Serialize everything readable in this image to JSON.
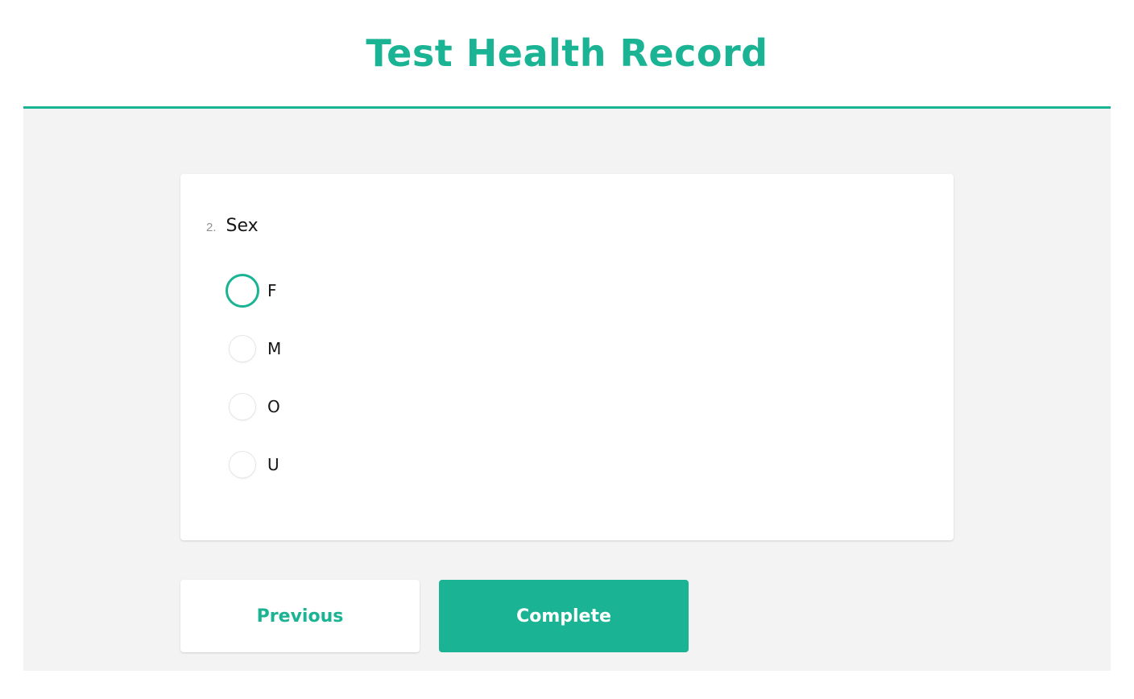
{
  "header": {
    "title": "Test Health Record"
  },
  "question": {
    "number": "2.",
    "text": "Sex",
    "options": [
      {
        "label": "F",
        "focused": true,
        "selected": false
      },
      {
        "label": "M",
        "focused": false,
        "selected": false
      },
      {
        "label": "O",
        "focused": false,
        "selected": false
      },
      {
        "label": "U",
        "focused": false,
        "selected": false
      }
    ]
  },
  "navigation": {
    "previous_label": "Previous",
    "complete_label": "Complete"
  },
  "colors": {
    "accent": "#1ab394",
    "background": "#f3f3f3",
    "card": "#ffffff"
  }
}
